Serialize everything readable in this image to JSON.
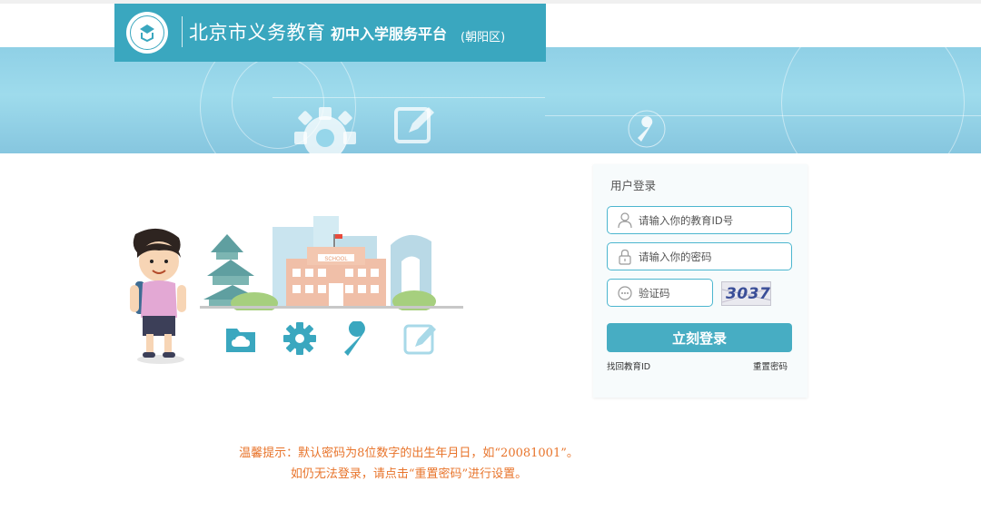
{
  "header": {
    "title": "北京市义务教育",
    "subtitle": "初中入学服务平台",
    "district": "(朝阳区)",
    "accent_color": "#3aa7bf"
  },
  "banner": {
    "icons": [
      "gear-icon",
      "edit-icon",
      "wrench-icon"
    ]
  },
  "illustration": {
    "sign_text": "SCHOOL",
    "icons": [
      "cloud-folder-icon",
      "gear-icon",
      "wrench-icon",
      "edit-icon"
    ]
  },
  "login": {
    "title": "用户登录",
    "id_placeholder": "请输入你的教育ID号",
    "password_placeholder": "请输入你的密码",
    "captcha_placeholder": "验证码",
    "captcha_code": "3037",
    "submit_label": "立刻登录",
    "forgot_id_label": "找回教育ID",
    "reset_password_label": "重置密码",
    "button_color": "#47adc3"
  },
  "tips": {
    "line1": "温馨提示：默认密码为8位数字的出生年月日，如“20081001”。",
    "line2": "如仍无法登录，请点击“重置密码”进行设置。",
    "color": "#e8742b"
  }
}
